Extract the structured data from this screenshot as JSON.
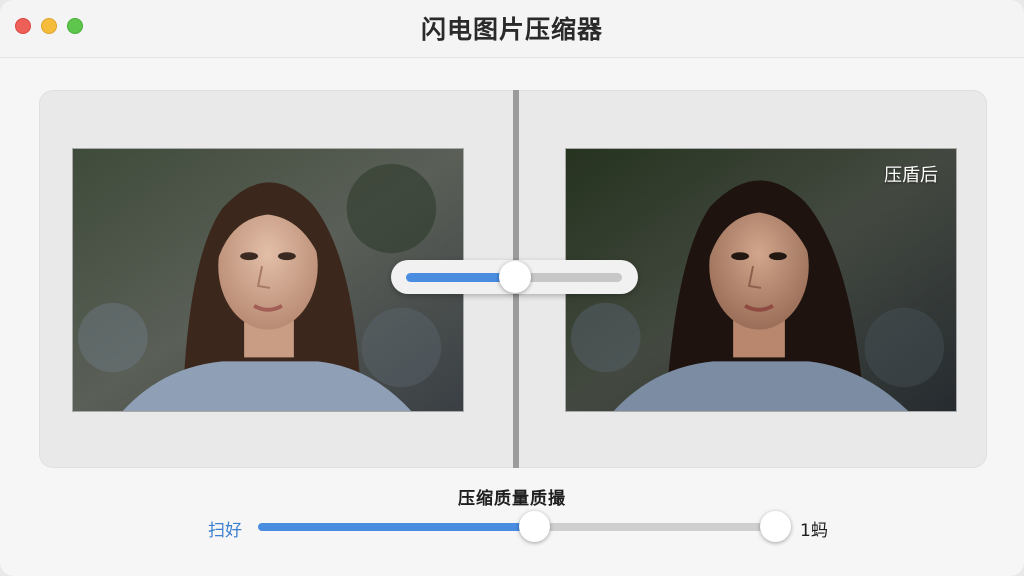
{
  "window": {
    "title": "闪电图片压缩器"
  },
  "compare": {
    "after_label": "压盾后",
    "split_slider_value": 0.5
  },
  "quality": {
    "label": "压缩质量质撮",
    "min_label": "扫好",
    "max_label": "1蚂",
    "value": 0.53
  },
  "colors": {
    "accent": "#4a8de0",
    "close": "#ee5f57",
    "minimize": "#f5bc3c",
    "maximize": "#5ec54d"
  }
}
